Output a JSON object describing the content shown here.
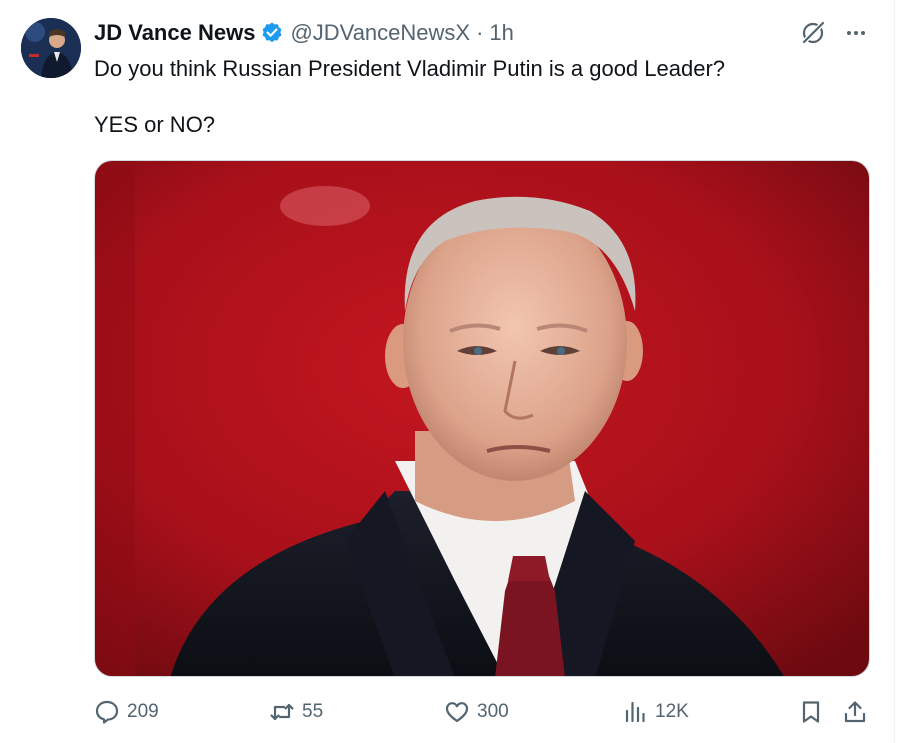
{
  "post": {
    "author_name": "JD Vance News",
    "handle": "@JDVanceNewsX",
    "separator": "·",
    "time": "1h",
    "verified": true,
    "text_line_1": "Do you think Russian President Vladimir Putin is a good Leader?",
    "text_line_2": "YES or NO?"
  },
  "icons": {
    "grok": "grok-slash-icon",
    "more": "more-dots-icon",
    "reply": "reply-bubble-icon",
    "repost": "repost-arrows-icon",
    "like": "heart-icon",
    "views": "bar-chart-icon",
    "bookmark": "bookmark-icon",
    "share": "share-upload-icon"
  },
  "metrics": {
    "replies": "209",
    "reposts": "55",
    "likes": "300",
    "views": "12K"
  },
  "colors": {
    "text": "#0f1419",
    "secondary": "#536471",
    "verified": "#1d9bf0",
    "media_background": "#b3131b"
  }
}
